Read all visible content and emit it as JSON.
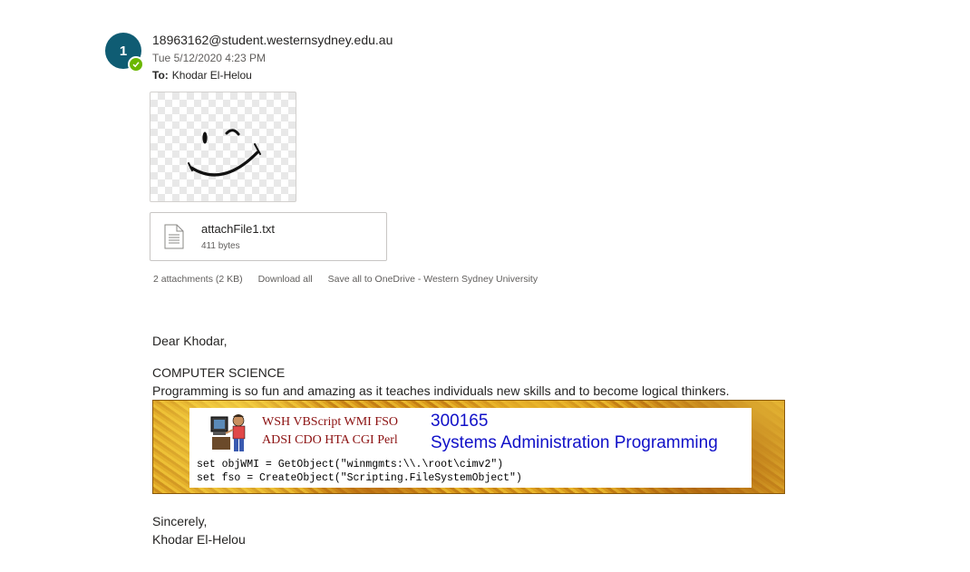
{
  "message": {
    "avatar_initial": "1",
    "sender": "18963162@student.westernsydney.edu.au",
    "date": "Tue 5/12/2020 4:23 PM",
    "to_label": "To:",
    "to": "Khodar El-Helou"
  },
  "attachments": {
    "image_icon": "winking-smiley",
    "file": {
      "name": "attachFile1.txt",
      "size": "411 bytes",
      "icon": "text-document-icon"
    },
    "summary": "2 attachments (2 KB)",
    "download_all": "Download all",
    "save_all": "Save all to OneDrive - Western Sydney University"
  },
  "body": {
    "greeting": "Dear Khodar,",
    "heading": "COMPUTER SCIENCE",
    "paragraph": "Programming is so fun and amazing as it teaches individuals new skills and to become logical thinkers.",
    "banner": {
      "tech_line1": "WSH VBScript WMI FSO",
      "tech_line2": "ADSI CDO HTA CGI Perl",
      "course_code": "300165",
      "course_title": "Systems Administration Programming",
      "code_line1": "set objWMI = GetObject(\"winmgmts:\\\\.\\root\\cimv2\")",
      "code_line2": "set fso = CreateObject(\"Scripting.FileSystemObject\")"
    },
    "closing": "Sincerely,",
    "signature": "Khodar El-Helou"
  },
  "colors": {
    "avatar": "#0f5c73",
    "presence": "#6bb700",
    "banner_text_red": "#8b1010",
    "banner_text_blue": "#1010c8"
  }
}
